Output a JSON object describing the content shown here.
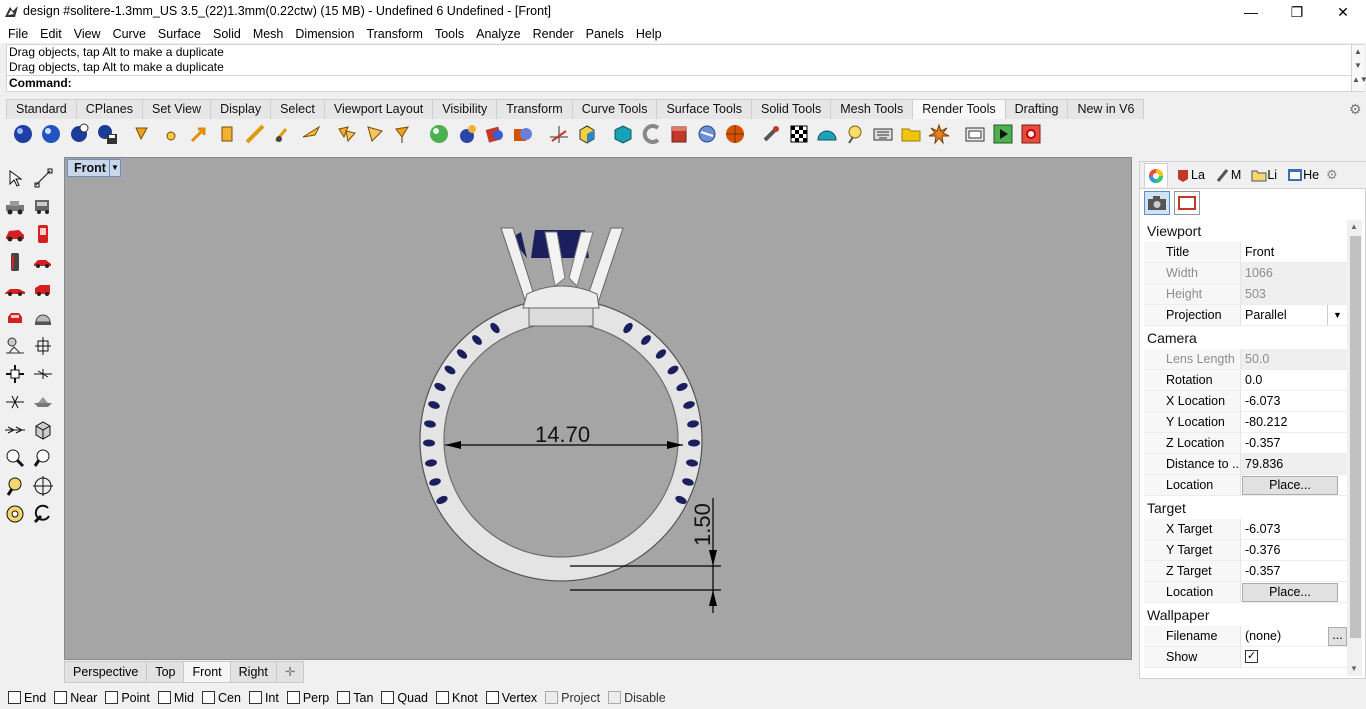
{
  "window": {
    "title": "design #solitere-1.3mm_US 3.5_(22)1.3mm(0.22ctw) (15 MB) - Undefined 6 Undefined - [Front]",
    "controls": [
      "—",
      "❐",
      "✕"
    ]
  },
  "menu": [
    "File",
    "Edit",
    "View",
    "Curve",
    "Surface",
    "Solid",
    "Mesh",
    "Dimension",
    "Transform",
    "Tools",
    "Analyze",
    "Render",
    "Panels",
    "Help"
  ],
  "command": {
    "history": [
      "Drag objects, tap Alt to make a duplicate",
      "Drag objects, tap Alt to make a duplicate"
    ],
    "prompt": "Command:"
  },
  "toolbar_tabs": [
    "Standard",
    "CPlanes",
    "Set View",
    "Display",
    "Select",
    "Viewport Layout",
    "Visibility",
    "Transform",
    "Curve Tools",
    "Surface Tools",
    "Solid Tools",
    "Mesh Tools",
    "Render Tools",
    "Drafting",
    "New in V6"
  ],
  "active_toolbar_tab": "Render Tools",
  "viewport": {
    "title": "Front",
    "dimension_diameter": "14.70",
    "dimension_thickness": "1.50"
  },
  "viewport_tabs": [
    "Perspective",
    "Top",
    "Front",
    "Right"
  ],
  "active_viewport_tab": "Front",
  "osnaps": [
    {
      "label": "End",
      "checked": false,
      "enabled": true
    },
    {
      "label": "Near",
      "checked": false,
      "enabled": true
    },
    {
      "label": "Point",
      "checked": false,
      "enabled": true
    },
    {
      "label": "Mid",
      "checked": false,
      "enabled": true
    },
    {
      "label": "Cen",
      "checked": false,
      "enabled": true
    },
    {
      "label": "Int",
      "checked": false,
      "enabled": true
    },
    {
      "label": "Perp",
      "checked": false,
      "enabled": true
    },
    {
      "label": "Tan",
      "checked": false,
      "enabled": true
    },
    {
      "label": "Quad",
      "checked": false,
      "enabled": true
    },
    {
      "label": "Knot",
      "checked": false,
      "enabled": true
    },
    {
      "label": "Vertex",
      "checked": false,
      "enabled": true
    },
    {
      "label": "Project",
      "checked": false,
      "enabled": false
    },
    {
      "label": "Disable",
      "checked": false,
      "enabled": false
    }
  ],
  "panel": {
    "tabs": [
      "La",
      "M",
      "Li",
      "He"
    ],
    "sections": {
      "viewport": {
        "heading": "Viewport",
        "title_label": "Title",
        "title_value": "Front",
        "width_label": "Width",
        "width_value": "1066",
        "height_label": "Height",
        "height_value": "503",
        "projection_label": "Projection",
        "projection_value": "Parallel"
      },
      "camera": {
        "heading": "Camera",
        "lens_label": "Lens Length",
        "lens_value": "50.0",
        "rotation_label": "Rotation",
        "rotation_value": "0.0",
        "xloc_label": "X Location",
        "xloc_value": "-6.073",
        "yloc_label": "Y Location",
        "yloc_value": "-80.212",
        "zloc_label": "Z Location",
        "zloc_value": "-0.357",
        "distance_label": "Distance to ...",
        "distance_value": "79.836",
        "location_label": "Location",
        "location_button": "Place..."
      },
      "target": {
        "heading": "Target",
        "xtarget_label": "X Target",
        "xtarget_value": "-6.073",
        "ytarget_label": "Y Target",
        "ytarget_value": "-0.376",
        "ztarget_label": "Z Target",
        "ztarget_value": "-0.357",
        "location_label": "Location",
        "location_button": "Place..."
      },
      "wallpaper": {
        "heading": "Wallpaper",
        "filename_label": "Filename",
        "filename_value": "(none)",
        "filename_button": "...",
        "show_label": "Show",
        "show_checked": true
      }
    }
  },
  "colors": {
    "viewport_bg": "#a5a5a5",
    "ring_metal": "#e4e4e4",
    "gem": "#1b1f5e",
    "active_viewport_title": "#c8d7ea"
  }
}
